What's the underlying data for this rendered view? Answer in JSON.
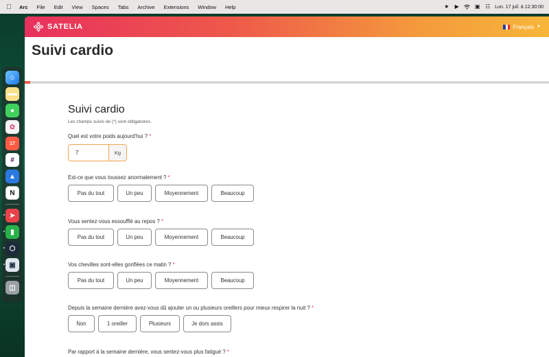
{
  "menubar": {
    "items": [
      "Arc",
      "File",
      "Edit",
      "View",
      "Spaces",
      "Tabs",
      "Archive",
      "Extensions",
      "Window",
      "Help"
    ],
    "datetime": "Lun. 17 juil. à 12:30:00"
  },
  "dock": {
    "icons": [
      "finder-icon",
      "notes-icon",
      "messages-icon",
      "photos-icon",
      "calendar-icon",
      "slack-icon",
      "app-icon",
      "notion-icon",
      "app2-icon",
      "numbers-icon",
      "app3-icon",
      "preview-icon",
      "trash-icon"
    ],
    "calendar_day": "17"
  },
  "header": {
    "brand": "SATELIA",
    "language": "Français",
    "brand_colors": [
      "#e8305d",
      "#f7b63a"
    ]
  },
  "page": {
    "title": "Suivi cardio",
    "progress_percent": 1
  },
  "form": {
    "title": "Suivi cardio",
    "required_note": "Les champs suivis de (*) sont obligatoires.",
    "weight": {
      "question": "Quel est votre poids aujourd'hui ?",
      "value": "7",
      "unit": "Kg"
    },
    "questions": [
      {
        "label": "Est-ce que vous toussez anormalement ?",
        "options": [
          "Pas du tout",
          "Un peu",
          "Moyennement",
          "Beaucoup"
        ]
      },
      {
        "label": "Vous sentez-vous essoufflé au repos ?",
        "options": [
          "Pas du tout",
          "Un peu",
          "Moyennement",
          "Beaucoup"
        ]
      },
      {
        "label": "Vos chevilles sont-elles gonflées ce matin ?",
        "options": [
          "Pas du tout",
          "Un peu",
          "Moyennement",
          "Beaucoup"
        ]
      },
      {
        "label": "Depuis la semaine dernière avez-vous dû ajouter un ou plusieurs oreillers pour mieux respirer la nuit ?",
        "options": [
          "Non",
          "1 oreiller",
          "Plusieurs",
          "Je dors assis"
        ]
      },
      {
        "label": "Par rapport à la semaine dernière, vous sentez-vous plus fatigué ?",
        "options": []
      }
    ]
  }
}
